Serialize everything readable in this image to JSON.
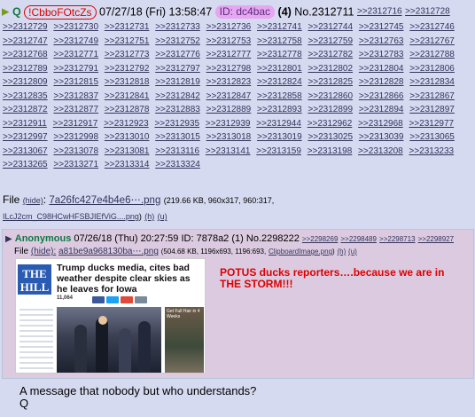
{
  "header": {
    "indicator": "▶",
    "name": "Q",
    "tripcode": "!CbboFOtcZs",
    "datetime": "07/27/18 (Fri) 13:58:47",
    "id_label": "ID: dc4bac",
    "reply_count": "(4)",
    "post_number": "No.2312711",
    "header_links": [
      ">>2312716",
      ">>2312728"
    ]
  },
  "backlinks": [
    ">>2312729",
    ">>2312730",
    ">>2312731",
    ">>2312733",
    ">>2312736",
    ">>2312741",
    ">>2312744",
    ">>2312745",
    ">>2312746",
    ">>2312747",
    ">>2312749",
    ">>2312751",
    ">>2312752",
    ">>2312753",
    ">>2312758",
    ">>2312759",
    ">>2312763",
    ">>2312767",
    ">>2312768",
    ">>2312771",
    ">>2312773",
    ">>2312776",
    ">>2312777",
    ">>2312778",
    ">>2312782",
    ">>2312783",
    ">>2312788",
    ">>2312789",
    ">>2312791",
    ">>2312792",
    ">>2312797",
    ">>2312798",
    ">>2312801",
    ">>2312802",
    ">>2312804",
    ">>2312806",
    ">>2312809",
    ">>2312815",
    ">>2312818",
    ">>2312819",
    ">>2312823",
    ">>2312824",
    ">>2312825",
    ">>2312828",
    ">>2312834",
    ">>2312835",
    ">>2312837",
    ">>2312841",
    ">>2312842",
    ">>2312847",
    ">>2312858",
    ">>2312860",
    ">>2312866",
    ">>2312867",
    ">>2312872",
    ">>2312877",
    ">>2312878",
    ">>2312883",
    ">>2312889",
    ">>2312893",
    ">>2312899",
    ">>2312894",
    ">>2312897",
    ">>2312911",
    ">>2312917",
    ">>2312923",
    ">>2312935",
    ">>2312939",
    ">>2312944",
    ">>2312962",
    ">>2312968",
    ">>2312977",
    ">>2312997",
    ">>2312998",
    ">>2313010",
    ">>2313015",
    ">>2313018",
    ">>2313019",
    ">>2313025",
    ">>2313039",
    ">>2313065",
    ">>2313067",
    ">>2313078",
    ">>2313081",
    ">>2313116",
    ">>2313141",
    ">>2313159",
    ">>2313198",
    ">>2313208",
    ">>2313233",
    ">>2313265",
    ">>2313271",
    ">>2313314",
    ">>2313324"
  ],
  "file": {
    "label": "File",
    "hide": "(hide)",
    "filename": "7a26fc427e4b4e6⋯.png",
    "meta": "(219.66 KB, 960x317, 960:317,",
    "orig_name": "ILcJ2cm_C98HCwHFSBJIEfViG....png",
    "suffix": ")",
    "h": "(h)",
    "u": "(u)"
  },
  "quoted_post": {
    "indicator": "▶",
    "name": "Anonymous",
    "datetime": "07/26/18 (Thu) 20:27:59",
    "id_label": "ID: 7878a2",
    "reply_count": "(1)",
    "post_number": "No.2298222",
    "links": [
      ">>2298269",
      ">>2298489",
      ">>2298713",
      ">>2298927"
    ],
    "file_label": "File",
    "file_hide": "(hide):",
    "file_name": "a81be9a968130ba⋯.png",
    "file_meta": "(504.68 KB, 1196x693, 1196:693,",
    "file_orig": "ClipboardImage.png",
    "file_suffix": ")",
    "h": "(h)",
    "u": "(u)",
    "thumb": {
      "logo": "THE HILL",
      "headline": "Trump ducks media, cites bad weather despite clear skies as he leaves for Iowa",
      "share_count": "11,064",
      "ad_text": "Get Full Hair in 4 Weeks",
      "share_colors": [
        "#3b5998",
        "#1da1f2",
        "#e04a3a",
        "#7a8a99"
      ]
    },
    "comment": "POTUS ducks reporters….because we are in THE STORM!!!"
  },
  "message": {
    "line1": "A message that nobody but who understands?",
    "line2": "Q"
  }
}
